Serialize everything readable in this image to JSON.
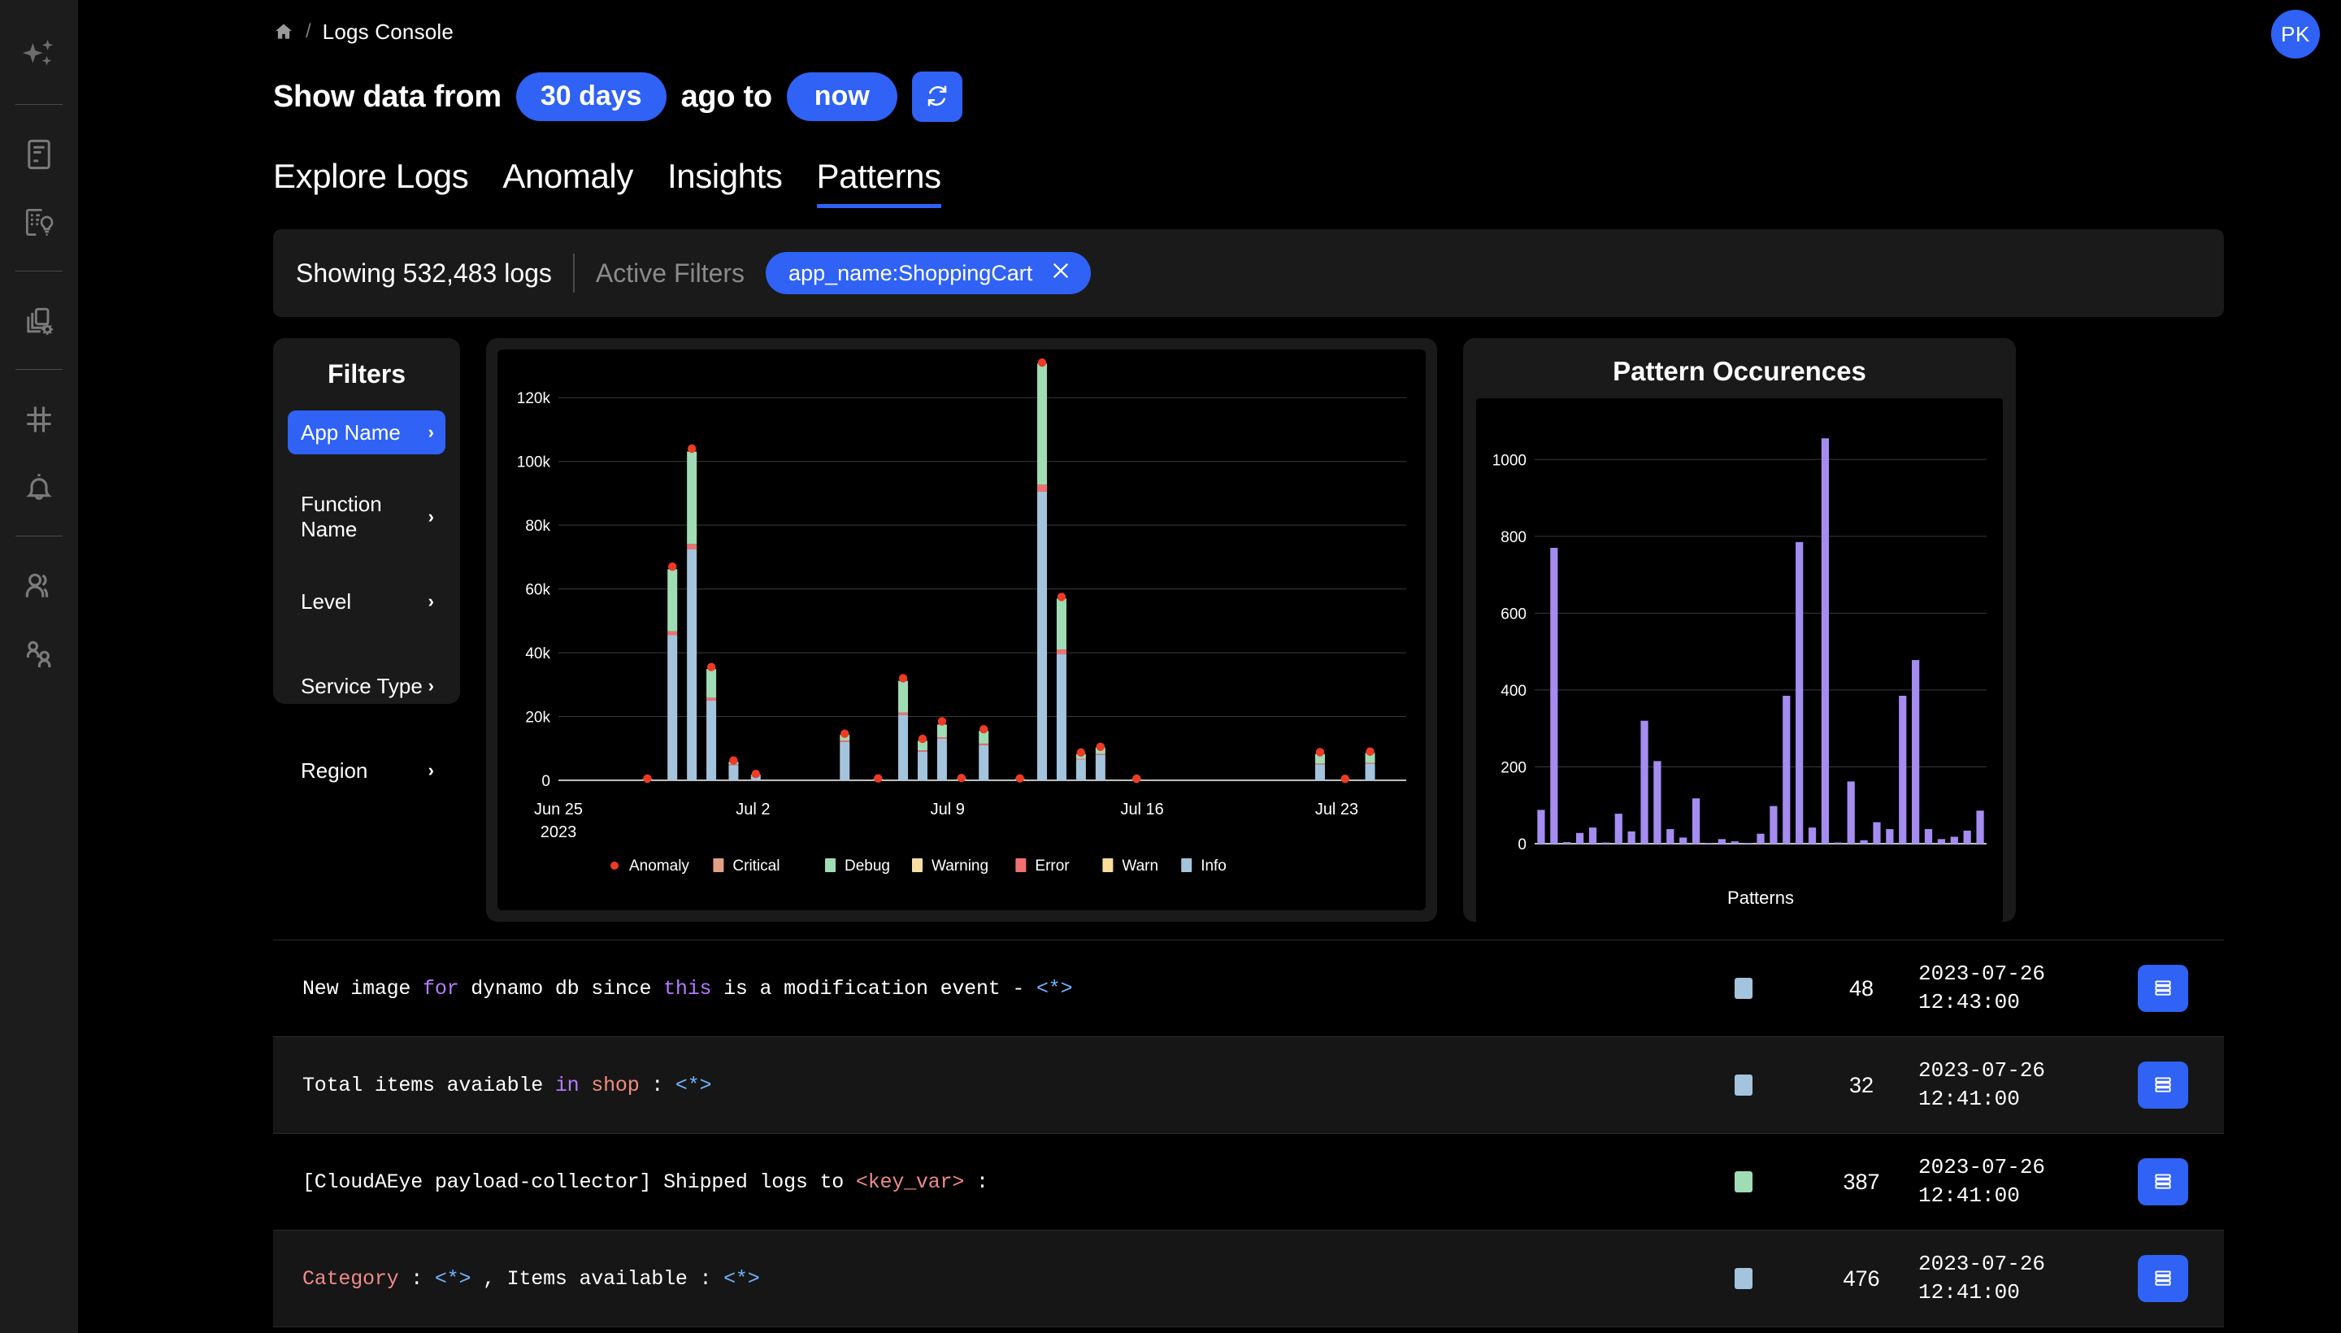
{
  "sidebar": {
    "items": [
      {
        "icon": "sparkle-icon",
        "name": "ai-assistant"
      },
      {
        "icon": "document-icon",
        "name": "logs"
      },
      {
        "icon": "insights-icon",
        "name": "insights"
      },
      {
        "icon": "layers-gear-icon",
        "name": "resources"
      },
      {
        "icon": "hash-icon",
        "name": "metrics"
      },
      {
        "icon": "bell-icon",
        "name": "alerts"
      },
      {
        "icon": "users-icon",
        "name": "teams"
      },
      {
        "icon": "user-group-icon",
        "name": "accounts"
      }
    ]
  },
  "breadcrumb": {
    "home_icon": "home-icon",
    "separator": "/",
    "current": "Logs Console"
  },
  "avatar": {
    "initials": "PK"
  },
  "timerange": {
    "prefix": "Show data from",
    "from": "30 days",
    "middle": "ago to",
    "to": "now",
    "refresh_icon": "refresh-icon"
  },
  "tabs": [
    {
      "label": "Explore Logs",
      "active": false
    },
    {
      "label": "Anomaly",
      "active": false
    },
    {
      "label": "Insights",
      "active": false
    },
    {
      "label": "Patterns",
      "active": true
    }
  ],
  "summary": {
    "count_text": "Showing 532,483 logs",
    "active_filters_label": "Active Filters",
    "chip_label": "app_name:ShoppingCart",
    "chip_close_icon": "close-icon"
  },
  "filters": {
    "title": "Filters",
    "items": [
      {
        "label": "App Name",
        "active": true
      },
      {
        "label": "Function Name",
        "active": false
      },
      {
        "label": "Level",
        "active": false
      },
      {
        "label": "Service Type",
        "active": false
      },
      {
        "label": "Region",
        "active": false
      }
    ]
  },
  "colors": {
    "accent": "#2f62f5",
    "anomaly": "#ee3b24",
    "critical": "#e0a184",
    "debug": "#a0dcb4",
    "warning": "#f7dfa4",
    "error": "#f07070",
    "warn": "#fadd9a",
    "info": "#a4c4dd",
    "pattern_bar": "#a48cf0"
  },
  "chart_data": [
    {
      "type": "bar",
      "id": "log-volume-timeline",
      "title": "",
      "xlabel": "",
      "ylabel": "",
      "ylim": [
        0,
        130000
      ],
      "yticks": [
        0,
        20000,
        40000,
        60000,
        80000,
        100000,
        120000
      ],
      "ytick_labels": [
        "0",
        "20k",
        "40k",
        "60k",
        "80k",
        "100k",
        "120k"
      ],
      "xtick_labels": [
        "Jun 25\n2023",
        "Jul 2",
        "Jul 9",
        "Jul 16",
        "Jul 23"
      ],
      "xtick_positions": [
        0,
        7,
        14,
        21,
        28
      ],
      "grid": true,
      "legend": [
        {
          "label": "Anomaly",
          "color": "#ee3b24",
          "marker": "dot"
        },
        {
          "label": "Critical",
          "color": "#e0a184",
          "marker": "square"
        },
        {
          "label": "Debug",
          "color": "#a0dcb4",
          "marker": "square"
        },
        {
          "label": "Warning",
          "color": "#f7dfa4",
          "marker": "square"
        },
        {
          "label": "Error",
          "color": "#f07070",
          "marker": "square"
        },
        {
          "label": "Warn",
          "color": "#fadd9a",
          "marker": "square"
        },
        {
          "label": "Info",
          "color": "#a4c4dd",
          "marker": "square"
        }
      ],
      "legend_position": "bottom",
      "bars": [
        {
          "x": 3.2,
          "info": 300,
          "error": 60,
          "debug": 150,
          "anomaly": 520
        },
        {
          "x": 4.1,
          "info": 45500,
          "error": 1200,
          "debug": 19500,
          "anomaly": 67000
        },
        {
          "x": 4.8,
          "info": 72500,
          "error": 1600,
          "debug": 29000,
          "anomaly": 104000
        },
        {
          "x": 5.5,
          "info": 25000,
          "error": 900,
          "debug": 9000,
          "anomaly": 35500
        },
        {
          "x": 6.3,
          "info": 4800,
          "error": 200,
          "debug": 800,
          "anomaly": 6200
        },
        {
          "x": 7.1,
          "info": 1200,
          "error": 120,
          "debug": 400,
          "anomaly": 2000
        },
        {
          "x": 10.3,
          "info": 12000,
          "error": 500,
          "debug": 1800,
          "anomaly": 14600
        },
        {
          "x": 11.5,
          "info": 300,
          "error": 60,
          "debug": 120,
          "anomaly": 600
        },
        {
          "x": 12.4,
          "info": 20500,
          "error": 700,
          "debug": 10000,
          "anomaly": 32000
        },
        {
          "x": 13.1,
          "info": 9000,
          "error": 400,
          "debug": 3000,
          "anomaly": 13000
        },
        {
          "x": 13.8,
          "info": 13000,
          "error": 500,
          "debug": 4000,
          "anomaly": 18500
        },
        {
          "x": 14.5,
          "info": 300,
          "error": 80,
          "debug": 150,
          "anomaly": 700
        },
        {
          "x": 15.3,
          "info": 11000,
          "error": 500,
          "debug": 4000,
          "anomaly": 16000
        },
        {
          "x": 16.6,
          "info": 300,
          "error": 60,
          "debug": 150,
          "anomaly": 600
        },
        {
          "x": 17.4,
          "info": 90500,
          "error": 2200,
          "debug": 38000,
          "anomaly": 131000
        },
        {
          "x": 18.1,
          "info": 39500,
          "error": 1500,
          "debug": 16000,
          "anomaly": 57500
        },
        {
          "x": 18.8,
          "info": 6500,
          "error": 250,
          "debug": 1500,
          "anomaly": 8700
        },
        {
          "x": 19.5,
          "info": 8000,
          "error": 300,
          "debug": 2000,
          "anomaly": 10500
        },
        {
          "x": 20.8,
          "info": 250,
          "error": 50,
          "debug": 100,
          "anomaly": 500
        },
        {
          "x": 27.4,
          "info": 5000,
          "error": 250,
          "debug": 3000,
          "anomaly": 8800
        },
        {
          "x": 28.3,
          "info": 200,
          "error": 40,
          "debug": 80,
          "anomaly": 450
        },
        {
          "x": 29.2,
          "info": 5200,
          "error": 260,
          "debug": 3100,
          "anomaly": 9000
        }
      ]
    },
    {
      "type": "bar",
      "id": "pattern-occurences",
      "title": "Pattern Occurences",
      "xlabel": "Patterns",
      "ylabel": "",
      "ylim": [
        0,
        1100
      ],
      "yticks": [
        0,
        200,
        400,
        600,
        800,
        1000
      ],
      "ytick_labels": [
        "0",
        "200",
        "400",
        "600",
        "800",
        "1000"
      ],
      "grid": true,
      "bar_color": "#a48cf0",
      "values": [
        88,
        770,
        4,
        28,
        42,
        3,
        78,
        32,
        320,
        215,
        38,
        16,
        118,
        2,
        12,
        6,
        2,
        26,
        98,
        385,
        785,
        42,
        1055,
        3,
        162,
        9,
        56,
        38,
        385,
        478,
        38,
        12,
        18,
        34,
        86
      ]
    }
  ],
  "log_rows": [
    {
      "segments": [
        {
          "t": "New image ",
          "c": "white"
        },
        {
          "t": "for",
          "c": "purple"
        },
        {
          "t": " dynamo db since ",
          "c": "white"
        },
        {
          "t": "this",
          "c": "purple"
        },
        {
          "t": " is a modification event - ",
          "c": "white"
        },
        {
          "t": "<*>",
          "c": "blue"
        }
      ],
      "level_color": "#a4c4dd",
      "count": "48",
      "date": "2023-07-26",
      "time": "12:43:00",
      "action_icon": "list-icon"
    },
    {
      "segments": [
        {
          "t": "Total items avaiable ",
          "c": "white"
        },
        {
          "t": "in ",
          "c": "purple"
        },
        {
          "t": "shop",
          "c": "salmon"
        },
        {
          "t": " : ",
          "c": "white"
        },
        {
          "t": "<*>",
          "c": "blue"
        }
      ],
      "level_color": "#a4c4dd",
      "count": "32",
      "date": "2023-07-26",
      "time": "12:41:00",
      "action_icon": "list-icon"
    },
    {
      "segments": [
        {
          "t": "[CloudAEye payload-collector] Shipped logs to ",
          "c": "white"
        },
        {
          "t": "<key_var>",
          "c": "red"
        },
        {
          "t": " :",
          "c": "white"
        }
      ],
      "level_color": "#a0dcb4",
      "count": "387",
      "date": "2023-07-26",
      "time": "12:41:00",
      "action_icon": "list-icon"
    },
    {
      "segments": [
        {
          "t": "Category",
          "c": "red"
        },
        {
          "t": " : ",
          "c": "white"
        },
        {
          "t": "<*>",
          "c": "blue"
        },
        {
          "t": " , Items available : ",
          "c": "white"
        },
        {
          "t": "<*>",
          "c": "blue"
        }
      ],
      "level_color": "#a4c4dd",
      "count": "476",
      "date": "2023-07-26",
      "time": "12:41:00",
      "action_icon": "list-icon"
    }
  ]
}
